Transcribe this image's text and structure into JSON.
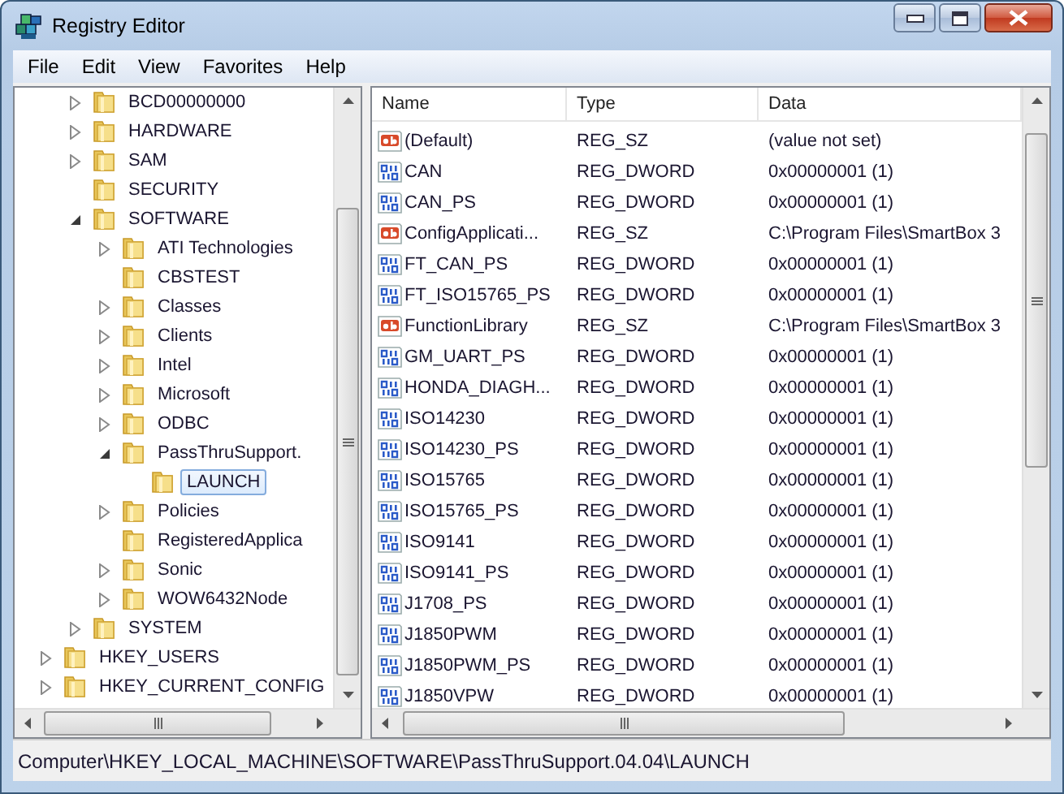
{
  "window": {
    "title": "Registry Editor"
  },
  "menu": [
    "File",
    "Edit",
    "View",
    "Favorites",
    "Help"
  ],
  "tree": [
    {
      "children": [
        {
          "label": "BCD00000000",
          "expanded": false,
          "selected": false
        },
        {
          "label": "HARDWARE",
          "expanded": false,
          "selected": false
        },
        {
          "label": "SAM",
          "expanded": false,
          "selected": false
        },
        {
          "label": "SECURITY",
          "selected": false
        },
        {
          "label": "SOFTWARE",
          "expanded": true,
          "selected": false,
          "children": [
            {
              "label": "ATI Technologies",
              "expanded": false,
              "selected": false
            },
            {
              "label": "CBSTEST",
              "selected": false
            },
            {
              "label": "Classes",
              "expanded": false,
              "selected": false
            },
            {
              "label": "Clients",
              "expanded": false,
              "selected": false
            },
            {
              "label": "Intel",
              "expanded": false,
              "selected": false
            },
            {
              "label": "Microsoft",
              "expanded": false,
              "selected": false
            },
            {
              "label": "ODBC",
              "expanded": false,
              "selected": false
            },
            {
              "label": "PassThruSupport.",
              "expanded": true,
              "selected": false,
              "children": [
                {
                  "label": "LAUNCH",
                  "selected": true
                }
              ]
            },
            {
              "label": "Policies",
              "expanded": false,
              "selected": false
            },
            {
              "label": "RegisteredApplica",
              "selected": false
            },
            {
              "label": "Sonic",
              "expanded": false,
              "selected": false
            },
            {
              "label": "WOW6432Node",
              "expanded": false,
              "selected": false
            }
          ]
        },
        {
          "label": "SYSTEM",
          "expanded": false,
          "selected": false
        }
      ]
    },
    {
      "label": "HKEY_USERS",
      "expanded": false,
      "selected": false
    },
    {
      "label": "HKEY_CURRENT_CONFIG",
      "expanded": false,
      "selected": false
    }
  ],
  "values": {
    "columns": [
      "Name",
      "Type",
      "Data"
    ],
    "rows": [
      {
        "kind": "string",
        "name": "(Default)",
        "type": "REG_SZ",
        "data": "(value not set)"
      },
      {
        "kind": "dword",
        "name": "CAN",
        "type": "REG_DWORD",
        "data": "0x00000001 (1)"
      },
      {
        "kind": "dword",
        "name": "CAN_PS",
        "type": "REG_DWORD",
        "data": "0x00000001 (1)"
      },
      {
        "kind": "string",
        "name": "ConfigApplicati...",
        "type": "REG_SZ",
        "data": "C:\\Program Files\\SmartBox 3"
      },
      {
        "kind": "dword",
        "name": "FT_CAN_PS",
        "type": "REG_DWORD",
        "data": "0x00000001 (1)"
      },
      {
        "kind": "dword",
        "name": "FT_ISO15765_PS",
        "type": "REG_DWORD",
        "data": "0x00000001 (1)"
      },
      {
        "kind": "string",
        "name": "FunctionLibrary",
        "type": "REG_SZ",
        "data": "C:\\Program Files\\SmartBox 3"
      },
      {
        "kind": "dword",
        "name": "GM_UART_PS",
        "type": "REG_DWORD",
        "data": "0x00000001 (1)"
      },
      {
        "kind": "dword",
        "name": "HONDA_DIAGH...",
        "type": "REG_DWORD",
        "data": "0x00000001 (1)"
      },
      {
        "kind": "dword",
        "name": "ISO14230",
        "type": "REG_DWORD",
        "data": "0x00000001 (1)"
      },
      {
        "kind": "dword",
        "name": "ISO14230_PS",
        "type": "REG_DWORD",
        "data": "0x00000001 (1)"
      },
      {
        "kind": "dword",
        "name": "ISO15765",
        "type": "REG_DWORD",
        "data": "0x00000001 (1)"
      },
      {
        "kind": "dword",
        "name": "ISO15765_PS",
        "type": "REG_DWORD",
        "data": "0x00000001 (1)"
      },
      {
        "kind": "dword",
        "name": "ISO9141",
        "type": "REG_DWORD",
        "data": "0x00000001 (1)"
      },
      {
        "kind": "dword",
        "name": "ISO9141_PS",
        "type": "REG_DWORD",
        "data": "0x00000001 (1)"
      },
      {
        "kind": "dword",
        "name": "J1708_PS",
        "type": "REG_DWORD",
        "data": "0x00000001 (1)"
      },
      {
        "kind": "dword",
        "name": "J1850PWM",
        "type": "REG_DWORD",
        "data": "0x00000001 (1)"
      },
      {
        "kind": "dword",
        "name": "J1850PWM_PS",
        "type": "REG_DWORD",
        "data": "0x00000001 (1)"
      },
      {
        "kind": "dword",
        "name": "J1850VPW",
        "type": "REG_DWORD",
        "data": "0x00000001 (1)"
      }
    ]
  },
  "status_bar": "Computer\\HKEY_LOCAL_MACHINE\\SOFTWARE\\PassThruSupport.04.04\\LAUNCH"
}
